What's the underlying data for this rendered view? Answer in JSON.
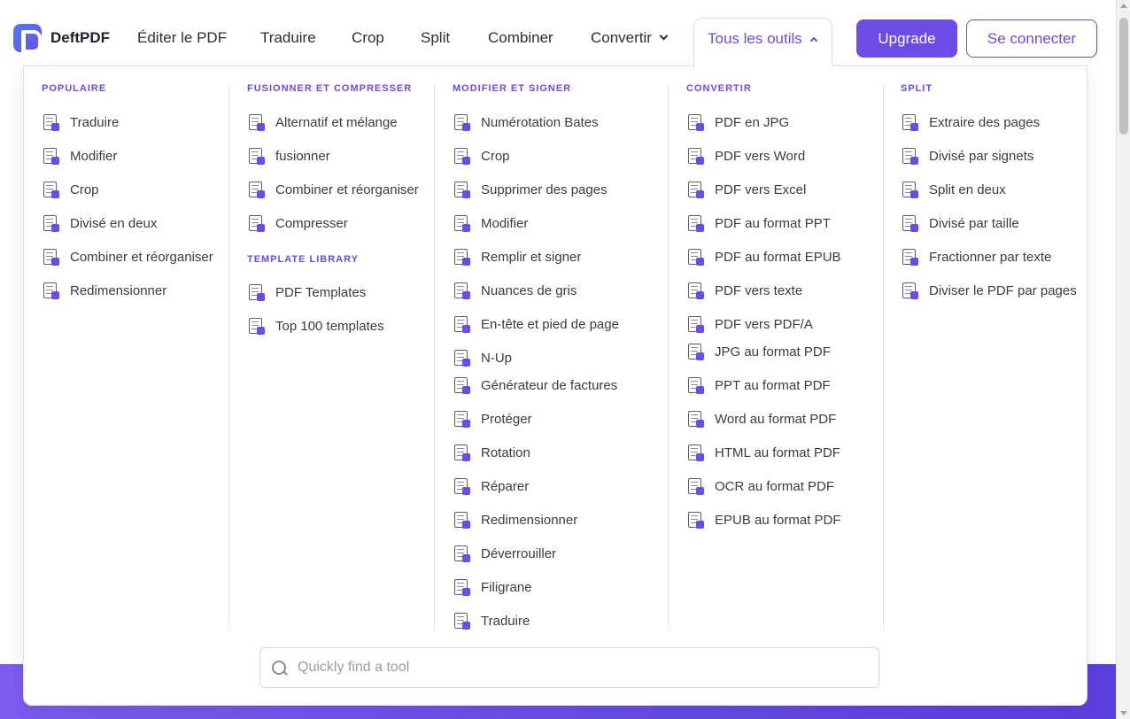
{
  "header": {
    "logo_text": "DeftPDF",
    "nav": [
      {
        "label": "Éditer le PDF"
      },
      {
        "label": "Traduire"
      },
      {
        "label": "Crop"
      },
      {
        "label": "Split"
      },
      {
        "label": "Combiner"
      },
      {
        "label": "Convertir"
      },
      {
        "label": "Tous les outils"
      }
    ],
    "upgrade_label": "Upgrade",
    "login_label": "Se connecter"
  },
  "colors": {
    "accent": "#6b4ce6",
    "text": "#2d2d3a",
    "band": "#6a4de8"
  },
  "columns": [
    {
      "title": "POPULAIRE",
      "items": [
        {
          "label": "Traduire",
          "icon": "translate-icon"
        },
        {
          "label": "Modifier",
          "icon": "edit-icon"
        },
        {
          "label": "Crop",
          "icon": "crop-icon"
        },
        {
          "label": "Divisé en deux",
          "icon": "split-half-icon"
        },
        {
          "label": "Combiner et réorganiser",
          "icon": "combine-icon"
        },
        {
          "label": "Redimensionner",
          "icon": "resize-icon"
        }
      ]
    },
    {
      "title": "FUSIONNER ET COMPRESSER",
      "items": [
        {
          "label": "Alternatif et mélange",
          "icon": "alternate-mix-icon"
        },
        {
          "label": "fusionner",
          "icon": "merge-icon"
        },
        {
          "label": "Combiner et réorganiser",
          "icon": "combine-icon"
        },
        {
          "label": "Compresser",
          "icon": "compress-icon"
        }
      ],
      "subtitle": "TEMPLATE LIBRARY",
      "sub_items": [
        {
          "label": "PDF Templates",
          "icon": "templates-icon"
        },
        {
          "label": "Top 100 templates",
          "icon": "top-100-icon"
        }
      ]
    },
    {
      "title": "MODIFIER ET SIGNER",
      "items": [
        {
          "label": "Numérotation Bates",
          "icon": "bates-icon"
        },
        {
          "label": "Crop",
          "icon": "crop-icon"
        },
        {
          "label": "Supprimer des pages",
          "icon": "delete-pages-icon"
        },
        {
          "label": "Modifier",
          "icon": "edit-icon"
        },
        {
          "label": "Remplir et signer",
          "icon": "fill-sign-icon"
        },
        {
          "label": "Nuances de gris",
          "icon": "grayscale-icon"
        },
        {
          "label": "En-tête et pied de page",
          "icon": "header-footer-icon"
        },
        {
          "label": "N-Up",
          "icon": "n-up-icon"
        },
        {
          "label": "Générateur de factures",
          "icon": "invoice-icon"
        },
        {
          "label": "Protéger",
          "icon": "protect-icon"
        },
        {
          "label": "Rotation",
          "icon": "rotate-icon"
        },
        {
          "label": "Réparer",
          "icon": "repair-icon"
        },
        {
          "label": "Redimensionner",
          "icon": "resize-icon"
        },
        {
          "label": "Déverrouiller",
          "icon": "unlock-icon"
        },
        {
          "label": "Filigrane",
          "icon": "watermark-icon"
        },
        {
          "label": "Traduire",
          "icon": "translate-icon"
        }
      ]
    },
    {
      "title": "CONVERTIR",
      "items": [
        {
          "label": "PDF en JPG",
          "icon": "pdf-to-jpg-icon"
        },
        {
          "label": "PDF vers Word",
          "icon": "pdf-to-word-icon"
        },
        {
          "label": "PDF vers Excel",
          "icon": "pdf-to-excel-icon"
        },
        {
          "label": "PDF au format PPT",
          "icon": "pdf-to-ppt-icon"
        },
        {
          "label": "PDF au format EPUB",
          "icon": "pdf-to-epub-icon"
        },
        {
          "label": "PDF vers texte",
          "icon": "pdf-to-text-icon"
        },
        {
          "label": "PDF vers PDF/A",
          "icon": "pdf-to-pdfa-icon"
        },
        {
          "label": "JPG au format PDF",
          "icon": "jpg-to-pdf-icon"
        },
        {
          "label": "PPT au format PDF",
          "icon": "ppt-to-pdf-icon"
        },
        {
          "label": "Word au format PDF",
          "icon": "word-to-pdf-icon"
        },
        {
          "label": "HTML au format PDF",
          "icon": "html-to-pdf-icon"
        },
        {
          "label": "OCR au format PDF",
          "icon": "ocr-to-pdf-icon"
        },
        {
          "label": "EPUB au format PDF",
          "icon": "epub-to-pdf-icon"
        }
      ]
    },
    {
      "title": "SPLIT",
      "items": [
        {
          "label": "Extraire des pages",
          "icon": "extract-pages-icon"
        },
        {
          "label": "Divisé par signets",
          "icon": "split-bookmarks-icon"
        },
        {
          "label": "Split en deux",
          "icon": "split-half-icon"
        },
        {
          "label": "Divisé par taille",
          "icon": "split-size-icon"
        },
        {
          "label": "Fractionner par texte",
          "icon": "split-text-icon"
        },
        {
          "label": "Diviser le PDF par pages",
          "icon": "split-pages-icon"
        }
      ]
    }
  ],
  "search": {
    "placeholder": "Quickly find a tool"
  }
}
